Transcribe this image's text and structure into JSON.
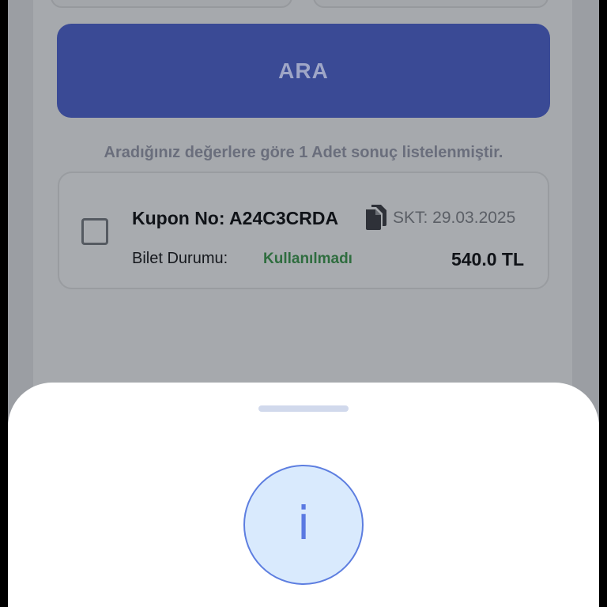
{
  "search": {
    "button_label": "ARA",
    "result_info": "Aradığınız değerlere göre 1 Adet sonuç listelenmiştir."
  },
  "ticket": {
    "coupon_label": "Kupon No: A24C3CRDA",
    "expiry": "SKT: 29.03.2025",
    "status_label": "Bilet Durumu:",
    "status_value": "Kullanılmadı",
    "price": "540.0 TL",
    "status_color": "#2f6d3f",
    "copy_icon": "copy-document-icon"
  },
  "sheet": {
    "icon": "info-icon",
    "icon_glyph": "i",
    "accent": "#5a79e2"
  },
  "colors": {
    "primary_button": "#3a4a95",
    "overlay": "#a6a9ad",
    "sheet_background": "#ffffff"
  }
}
